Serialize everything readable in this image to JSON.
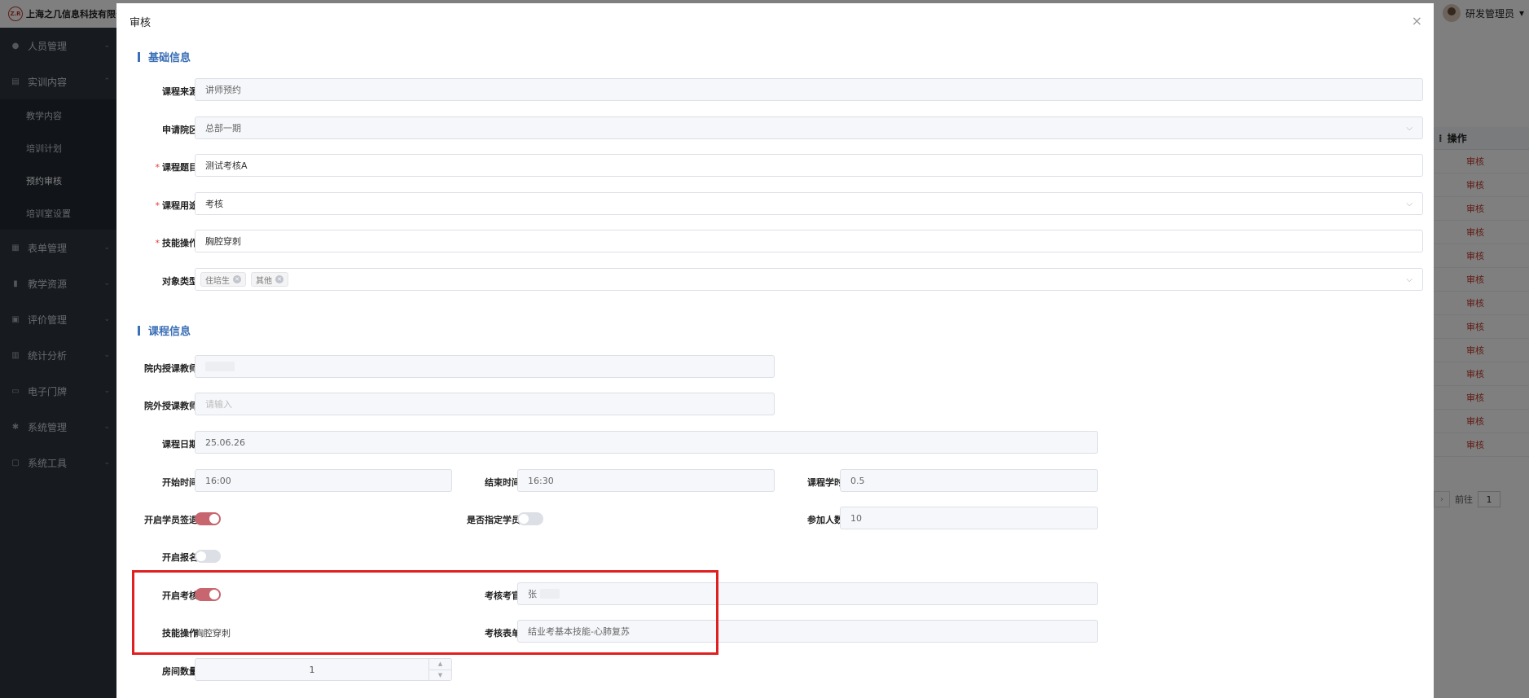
{
  "app": {
    "title": "上海之几信息科技有限公司",
    "logo_text": "Z.R",
    "user_name": "研发管理员",
    "user_caret": "▾"
  },
  "sidebar": {
    "items": [
      {
        "label": "人员管理",
        "icon": "user-icon"
      },
      {
        "label": "实训内容",
        "icon": "doc-icon"
      },
      {
        "label": "表单管理",
        "icon": "form-icon"
      },
      {
        "label": "教学资源",
        "icon": "book-icon"
      },
      {
        "label": "评价管理",
        "icon": "rate-icon"
      },
      {
        "label": "统计分析",
        "icon": "chart-icon"
      },
      {
        "label": "电子门牌",
        "icon": "monitor-icon"
      },
      {
        "label": "系统管理",
        "icon": "gear-icon"
      },
      {
        "label": "系统工具",
        "icon": "toolbox-icon"
      }
    ],
    "sub_items": [
      "教学内容",
      "培训计划",
      "预约审核",
      "培训室设置"
    ]
  },
  "table": {
    "header_label": "操作",
    "row_action": "审核",
    "rows": 13
  },
  "pager": {
    "goto_label": "前往",
    "page": "1"
  },
  "dialog": {
    "title": "审核",
    "close": "×",
    "sections": {
      "basic": "基础信息",
      "course": "课程信息"
    },
    "basic": {
      "source_label": "课程来源",
      "source_value": "讲师预约",
      "campus_label": "申请院区",
      "campus_value": "总部一期",
      "topic_label": "课程题目",
      "topic_value": "测试考核A",
      "purpose_label": "课程用途",
      "purpose_value": "考核",
      "skill_label": "技能操作",
      "skill_value": "胸腔穿刺",
      "target_label": "对象类型",
      "target_tags": [
        "住培生",
        "其他"
      ],
      "required_mark": "*"
    },
    "course": {
      "inner_teacher_label": "院内授课教师",
      "outer_teacher_label": "院外授课教师",
      "outer_teacher_placeholder": "请输入",
      "date_label": "课程日期",
      "date_value": "25.06.26",
      "start_label": "开始时间",
      "start_value": "16:00",
      "end_label": "结束时间",
      "end_value": "16:30",
      "hours_label": "课程学时",
      "hours_value": "0.5",
      "signin_label": "开启学员签退",
      "signin_on": true,
      "assign_label": "是否指定学员",
      "assign_on": false,
      "count_label": "参加人数",
      "count_value": "10",
      "enroll_label": "开启报名",
      "enroll_on": false,
      "exam_label": "开启考核",
      "exam_on": true,
      "examiner_label": "考核考官",
      "examiner_value": "张",
      "exam_skill_label": "技能操作",
      "exam_skill_value": "胸腔穿刺",
      "exam_form_label": "考核表单",
      "exam_form_value": "结业考基本技能-心肺复苏",
      "rooms_label": "房间数量",
      "rooms_value": "1"
    }
  }
}
